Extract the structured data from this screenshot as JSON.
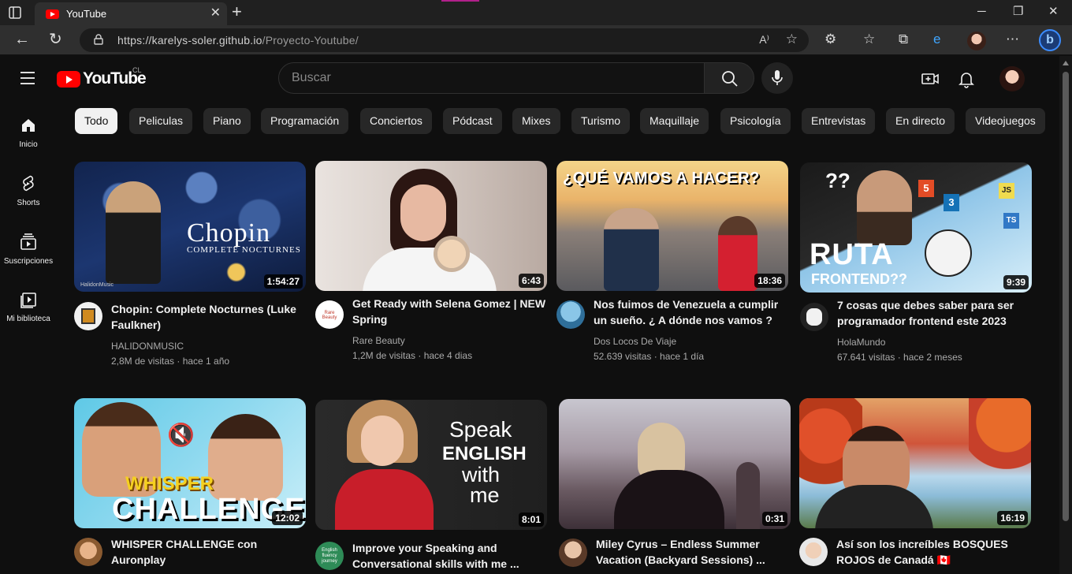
{
  "browser": {
    "tab_title": "YouTube",
    "url_host": "https://karelys-soler.github.io",
    "url_path": "/Proyecto-Youtube/",
    "read_aloud": "A⁾"
  },
  "header": {
    "logo_text": "YouTube",
    "country_code": "CL",
    "search_placeholder": "Buscar"
  },
  "guide": [
    {
      "label": "Inicio",
      "icon": "home-icon"
    },
    {
      "label": "Shorts",
      "icon": "shorts-icon"
    },
    {
      "label": "Suscripciones",
      "icon": "subscriptions-icon"
    },
    {
      "label": "Mi biblioteca",
      "icon": "library-icon"
    }
  ],
  "chips": [
    "Todo",
    "Peliculas",
    "Piano",
    "Programación",
    "Conciertos",
    "Pódcast",
    "Mixes",
    "Turismo",
    "Maquillaje",
    "Psicología",
    "Entrevistas",
    "En directo",
    "Videojuegos"
  ],
  "videos": [
    {
      "title": "Chopin: Complete Nocturnes (Luke Faulkner)",
      "channel": "HALIDONMUSIC",
      "meta": "2,8M de visitas · hace 1 año",
      "duration": "1:54:27",
      "thumb_line1": "Chopin",
      "thumb_line2": "COMPLETE NOCTURNES",
      "thumb_tag": "HalidonMusic"
    },
    {
      "title": "Get Ready with Selena Gomez | NEW Spring",
      "channel": "Rare Beauty",
      "meta": "1,2M de visitas · hace 4 dias",
      "duration": "6:43",
      "avatar_text": "Rare Beauty"
    },
    {
      "title": "Nos fuimos de Venezuela a cumplir un sueño. ¿ A dónde nos vamos ?",
      "channel": "Dos Locos De Viaje",
      "meta": "52.639 visitas · hace 1 día",
      "duration": "18:36",
      "thumb_line1": "¿QUÉ VAMOS A HACER?"
    },
    {
      "title": "7 cosas que debes saber para ser programador frontend este 2023",
      "channel": "HolaMundo",
      "meta": "67.641 visitas · hace 2 meses",
      "duration": "9:39",
      "thumb_line1": "??",
      "thumb_line2": "RUTA",
      "thumb_line3": "FRONTEND??",
      "thumb_tag1": "5",
      "thumb_tag2": "3",
      "thumb_tag3": "JS",
      "thumb_tag4": "TS"
    },
    {
      "title": "WHISPER CHALLENGE con Auronplay",
      "duration": "12:02",
      "thumb_line1": "WHISPER",
      "thumb_line2": "CHALLENGE"
    },
    {
      "title": "Improve your Speaking and Conversational skills with me ...",
      "duration": "8:01",
      "thumb_line1": "Speak",
      "thumb_line2": "ENGLISH",
      "thumb_line3": "with",
      "thumb_line4": "me",
      "avatar_text": "English fluency journey"
    },
    {
      "title": "Miley Cyrus – Endless Summer Vacation (Backyard Sessions) ...",
      "duration": "0:31"
    },
    {
      "title": "Así son los increíbles BOSQUES ROJOS de Canadá 🇨🇦",
      "duration": "16:19"
    }
  ]
}
